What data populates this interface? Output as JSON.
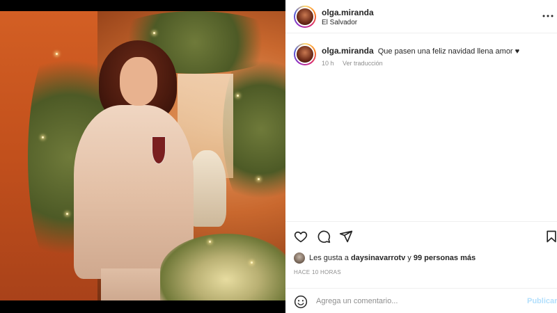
{
  "post": {
    "username": "olga.miranda",
    "location": "El Salvador",
    "caption_text": "Que pasen una feliz navidad llena amor ♥",
    "caption_time": "10 h",
    "translate_label": "Ver traducción",
    "likes_prefix": "Les gusta a",
    "likes_user": "daysinavarrotv",
    "likes_and": "y",
    "likes_others": "99 personas más",
    "time_ago": "HACE 10 HORAS"
  },
  "comment": {
    "placeholder": "Agrega un comentario...",
    "publish_label": "Publicar"
  },
  "icons": {
    "more": "more-options-icon",
    "like": "heart-icon",
    "comment": "comment-icon",
    "share": "share-icon",
    "save": "bookmark-icon",
    "emoji": "emoji-icon"
  },
  "colors": {
    "publish": "#b2dffc",
    "muted": "#8e8e8e",
    "text": "#262626"
  }
}
